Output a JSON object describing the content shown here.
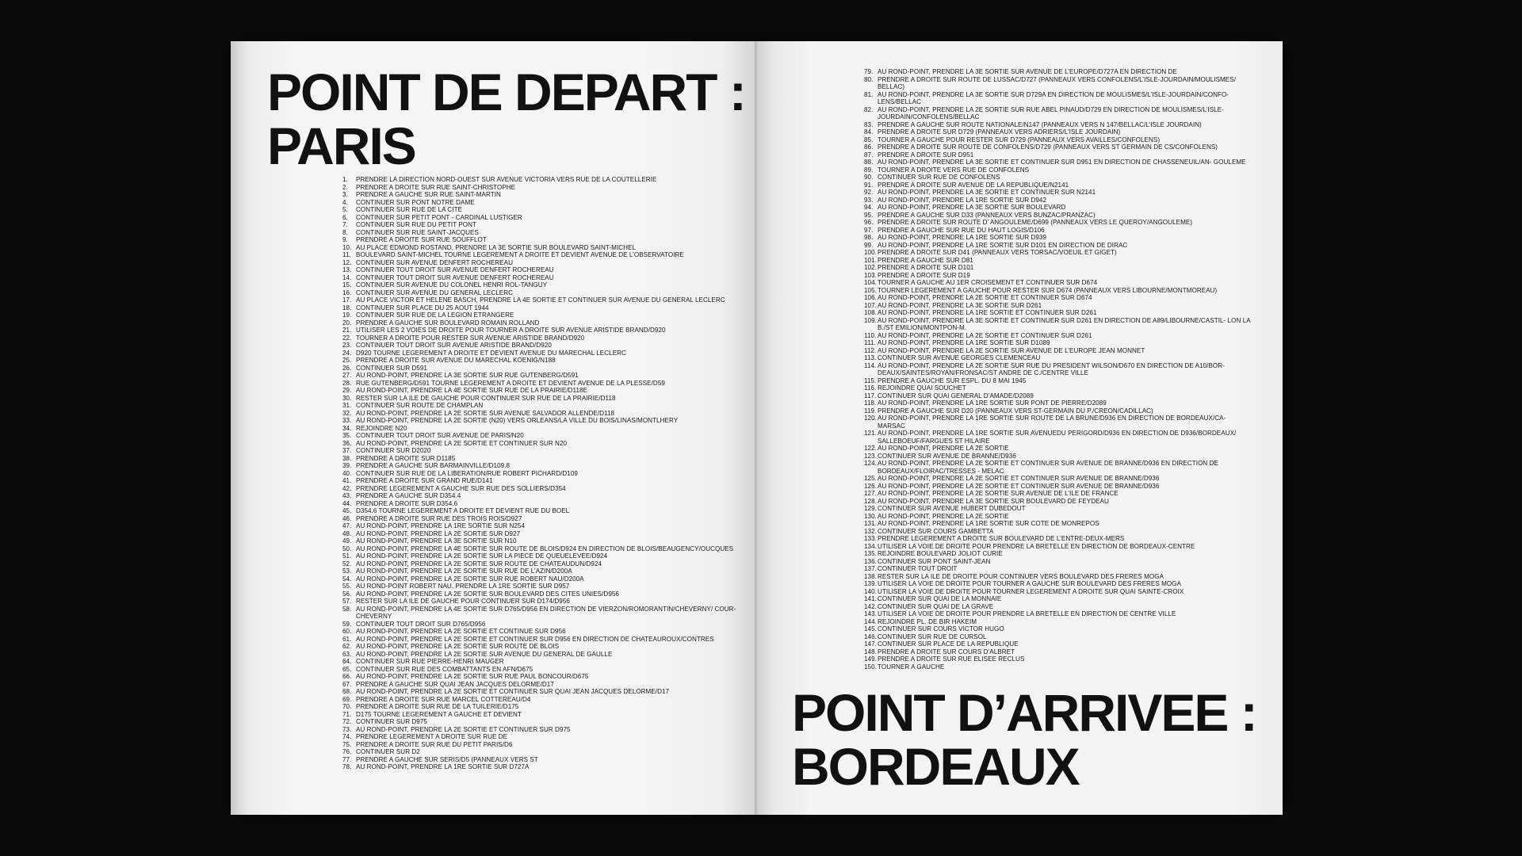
{
  "departure": {
    "label": "POINT DE DEPART :",
    "city": "PARIS"
  },
  "arrival": {
    "label": "POINT D’ARRIVEE :",
    "city": "BORDEAUX"
  },
  "steps_left": [
    {
      "num": "1.",
      "text": "PRENDRE LA DIRECTION NORD-OUEST SUR AVENUE VICTORIA VERS RUE DE LA COUTELLERIE"
    },
    {
      "num": "2.",
      "text": "PRENDRE A DROITE SUR RUE SAINT-CHRISTOPHE"
    },
    {
      "num": "3.",
      "text": "PRENDRE A GAUCHE SUR RUE SAINT-MARTIN"
    },
    {
      "num": "4.",
      "text": "CONTINUER SUR PONT NOTRE DAME"
    },
    {
      "num": "5.",
      "text": "CONTINUER SUR RUE DE LA CITE"
    },
    {
      "num": "6.",
      "text": "CONTINUER SUR PETIT PONT - CARDINAL LUSTIGER"
    },
    {
      "num": "7.",
      "text": "CONTINUER SUR RUE DU PETIT PONT"
    },
    {
      "num": "8.",
      "text": "CONTINUER SUR RUE SAINT-JACQUES"
    },
    {
      "num": "9.",
      "text": "PRENDRE A DROITE SUR RUE SOUFFLOT"
    },
    {
      "num": "10.",
      "text": "AU PLACE EDMOND ROSTAND, PRENDRE LA 3E SORTIE SUR BOULEVARD SAINT-MICHEL"
    },
    {
      "num": "11.",
      "text": "BOULEVARD SAINT-MICHEL TOURNE LEGEREMENT A DROITE ET DEVIENT AVENUE DE L’OBSERVATOIRE"
    },
    {
      "num": "12.",
      "text": "CONTINUER SUR AVENUE DENFERT ROCHEREAU"
    },
    {
      "num": "13.",
      "text": "CONTINUER TOUT DROIT SUR AVENUE DENFERT ROCHEREAU"
    },
    {
      "num": "14.",
      "text": "CONTINUER TOUT DROIT SUR AVENUE DENFERT ROCHEREAU"
    },
    {
      "num": "15.",
      "text": "CONTINUER SUR AVENUE DU COLONEL HENRI ROL-TANGUY"
    },
    {
      "num": "16.",
      "text": "CONTINUER SUR AVENUE DU GENERAL LECLERC"
    },
    {
      "num": "17.",
      "text": "AU PLACE VICTOR ET HELENE BASCH, PRENDRE LA 4E SORTIE ET CONTINUER SUR AVENUE DU GENERAL LECLERC"
    },
    {
      "num": "18.",
      "text": "CONTINUER SUR PLACE DU 25 AOUT 1944"
    },
    {
      "num": "19.",
      "text": "CONTINUER SUR RUE DE LA LEGION ETRANGERE"
    },
    {
      "num": "20.",
      "text": "PRENDRE A GAUCHE SUR BOULEVARD ROMAIN ROLLAND"
    },
    {
      "num": "21.",
      "text": "UTILISER LES 2 VOIES DE DROITE POUR TOURNER A DROITE SUR AVENUE ARISTIDE BRAND/D920"
    },
    {
      "num": "22.",
      "text": "TOURNER A DROITE POUR RESTER SUR AVENUE ARISTIDE BRAND/D920"
    },
    {
      "num": "23.",
      "text": "CONTINUER TOUT DROIT SUR AVENUE ARISTIDE BRAND/D920"
    },
    {
      "num": "24.",
      "text": "D920 TOURNE LEGEREMENT A DROITE ET DEVIENT AVENUE DU MARECHAL LECLERC"
    },
    {
      "num": "25.",
      "text": "PRENDRE A DROITE SUR AVENUE DU MARECHAL KOENIG/N188"
    },
    {
      "num": "26.",
      "text": "CONTINUER SUR D591"
    },
    {
      "num": "27.",
      "text": "AU ROND-POINT, PRENDRE LA 3E SORTIE SUR RUE GUTENBERG/D591"
    },
    {
      "num": "28.",
      "text": "RUE GUTENBERG/D591 TOURNE LEGEREMENT A DROITE ET DEVIENT AVENUE DE LA PLESSE/D59"
    },
    {
      "num": "29.",
      "text": "AU ROND-POINT, PRENDRE LA 4E SORTIE SUR RUE DE LA PRAIRIE/D118E"
    },
    {
      "num": "30.",
      "text": "RESTER SUR LA ILE DE GAUCHE POUR CONTINUER SUR RUE DE LA PRAIRIE/D118"
    },
    {
      "num": "31.",
      "text": "CONTINUER SUR ROUTE DE CHAMPLAN"
    },
    {
      "num": "32.",
      "text": "AU ROND-POINT, PRENDRE LA 2E SORTIE SUR AVENUE SALVADOR ALLENDE/D118"
    },
    {
      "num": "33.",
      "text": "AU ROND-POINT, PRENDRE LA 2E SORTIE (N20) VERS ORLEANS/LA VILLE DU BOIS/LINAS/MONTLHERY"
    },
    {
      "num": "34.",
      "text": "REJOINDRE N20"
    },
    {
      "num": "35.",
      "text": "CONTINUER TOUT DROIT SUR AVENUE DE PARIS/N20"
    },
    {
      "num": "36.",
      "text": "AU ROND-POINT, PRENDRE LA 2E SORTIE ET CONTINUER SUR N20"
    },
    {
      "num": "37.",
      "text": "CONTINUER SUR D2020"
    },
    {
      "num": "38.",
      "text": "PRENDRE A DROITE SUR D1185"
    },
    {
      "num": "39.",
      "text": "PRENDRE A GAUCHE SUR BARMAINVILLE/D109.8"
    },
    {
      "num": "40.",
      "text": "CONTINUER SUR RUE DE LA LIBERATION/RUE ROBERT PICHARD/D109"
    },
    {
      "num": "41.",
      "text": "PRENDRE A DROITE SUR GRAND RUE/D141"
    },
    {
      "num": "42.",
      "text": "PRENDRE LEGEREMENT A GAUCHE SUR RUE DES SOLLIERS/D354"
    },
    {
      "num": "43.",
      "text": "PRENDRE A GAUCHE SUR D354.4"
    },
    {
      "num": "44.",
      "text": "PRENDRE A DROITE SUR D354.6"
    },
    {
      "num": "45.",
      "text": "D354.6 TOURNE LEGEREMENT A DROITE ET DEVIENT RUE DU BOEL"
    },
    {
      "num": "46.",
      "text": "PRENDRE A DROITE SUR RUE DES TROIS ROIS/D927"
    },
    {
      "num": "47.",
      "text": "AU ROND-POINT, PRENDRE LA 1RE SORTIE SUR N254"
    },
    {
      "num": "48.",
      "text": "AU ROND-POINT, PRENDRE LA 2E SORTIE SUR D927"
    },
    {
      "num": "49.",
      "text": "AU ROND-POINT, PRENDRE LA 3E SORTIE SUR N10"
    },
    {
      "num": "50.",
      "text": "AU ROND-POINT, PRENDRE LA 4E SORTIE SUR ROUTE DE BLOIS/D924 EN DIRECTION DE BLOIS/BEAUGENCY/OUCQUES"
    },
    {
      "num": "51.",
      "text": "AU ROND-POINT, PRENDRE LA 2E SORTIE SUR LA PIECE DE QUEUELEVEE/D924"
    },
    {
      "num": "52.",
      "text": "AU ROND-POINT, PRENDRE LA 2E SORTIE SUR ROUTE DE CHATEAUDUN/D924"
    },
    {
      "num": "53.",
      "text": "AU ROND-POINT, PRENDRE LA 2E SORTIE SUR RUE DE L’AZIN/D200A"
    },
    {
      "num": "54.",
      "text": "AU ROND-POINT, PRENDRE LA 2E SORTIE SUR RUE ROBERT NAU/D200A"
    },
    {
      "num": "55.",
      "text": "AU ROND-POINT ROBERT NAU, PRENDRE LA 1RE SORTIE SUR D957"
    },
    {
      "num": "56.",
      "text": "AU ROND-POINT, PRENDRE LA 2E SORTIE SUR BOULEVARD DES CITES UNIES/D956"
    },
    {
      "num": "57.",
      "text": "RESTER SUR LA ILE DE GAUCHE POUR CONTINUER SUR D174/D956"
    },
    {
      "num": "58.",
      "text": "AU ROND-POINT, PRENDRE LA 4E SORTIE SUR D765/D956 EN DIRECTION DE VIERZON/ROMORANTIN/CHEVERNY/ COUR-CHEVERNY"
    },
    {
      "num": "59.",
      "text": "CONTINUER TOUT DROIT SUR D765/D956"
    },
    {
      "num": "60.",
      "text": "AU ROND-POINT, PRENDRE LA 2E SORTIE ET CONTINUE SUR D956"
    },
    {
      "num": "61.",
      "text": "AU ROND-POINT, PRENDRE LA 2E SORTIE ET CONTINUER SUR D956 EN DIRECTION DE CHATEAUROUX/CONTRES"
    },
    {
      "num": "62.",
      "text": "AU ROND-POINT, PRENDRE LA 2E SORTIE SUR ROUTE DE BLOIS"
    },
    {
      "num": "63.",
      "text": "AU ROND-POINT, PRENDRE LA 2E SORTIE SUR AVENUE DU GENERAL DE GAULLE"
    },
    {
      "num": "64.",
      "text": "CONTINUER SUR RUE PIERRE-HENRI MAUGER"
    },
    {
      "num": "65.",
      "text": "CONTINUER SUR RUE DES COMBATTANTS EN AFN/D675"
    },
    {
      "num": "66.",
      "text": "AU ROND-POINT, PRENDRE LA 2E SORTIE SUR RUE PAUL BONCOUR/D675"
    },
    {
      "num": "67.",
      "text": "PRENDRE A GAUCHE SUR QUAI JEAN JACQUES DELORME/D17"
    },
    {
      "num": "68.",
      "text": "AU ROND-POINT, PRENDRE LA 2E SORTIE ET CONTINUER SUR QUAI JEAN JACQUES DELORME/D17"
    },
    {
      "num": "69.",
      "text": "PRENDRE A DROITE SUR RUE MARCEL COTTEREAU/D4"
    },
    {
      "num": "70.",
      "text": "PRENDRE A DROITE SUR RUE DE LA TUILERIE/D175"
    },
    {
      "num": "71.",
      "text": "D175 TOURNE LEGEREMENT A GAUCHE ET DEVIENT"
    },
    {
      "num": "72.",
      "text": "CONTINUER SUR D975"
    },
    {
      "num": "73.",
      "text": "AU ROND-POINT, PRENDRE LA 2E SORTIE ET CONTINUER SUR D975"
    },
    {
      "num": "74.",
      "text": "PRENDRE LEGEREMENT A DROITE SUR RUE DE"
    },
    {
      "num": "75.",
      "text": "PRENDRE A DROITE SUR RUE DU PETIT PARIS/D6"
    },
    {
      "num": "76.",
      "text": "CONTINUER SUR D2"
    },
    {
      "num": "77.",
      "text": "PRENDRE A GAUCHE SUR SERIS/D5 (PANNEAUX VERS ST"
    },
    {
      "num": "78.",
      "text": "AU ROND-POINT, PRENDRE LA 1RE SORTIE SUR D727A"
    }
  ],
  "steps_right": [
    {
      "num": "79.",
      "text": "AU ROND-POINT, PRENDRE LA 3E SORTIE SUR AVENUE DE L’EUROPE/D727A EN DIRECTION DE"
    },
    {
      "num": "80.",
      "text": "PRENDRE A DROITE SUR ROUTE DE LUSSAC/D727 (PANNEAUX VERS CONFOLENS/L’ISLE-JOURDAIN/MOULISMES/ BELLAC)"
    },
    {
      "num": "81.",
      "text": "AU ROND-POINT, PRENDRE LA 3E SORTIE SUR D729A EN DIRECTION DE MOULISMES/L’ISLE-JOURDAIN/CONFO- LENS/BELLAC"
    },
    {
      "num": "82.",
      "text": "AU ROND-POINT, PRENDRE LA 2E SORTIE SUR RUE ABEL PINAUD/D729 EN DIRECTION DE MOULISMES/L’ISLE- JOURDAIN/CONFOLENS/BELLAC"
    },
    {
      "num": "83.",
      "text": "PRENDRE A GAUCHE SUR ROUTE NATIONALE/N147 (PANNEAUX VERS N 147/BELLAC/L’ISLE JOURDAIN)"
    },
    {
      "num": "84.",
      "text": "PRENDRE A DROITE SUR D729 (PANNEAUX VERS ADRIERS/L’ISLE JOURDAIN)"
    },
    {
      "num": "85.",
      "text": "TOURNER A GAUCHE POUR RESTER SUR D729 (PANNEAUX VERS AVAILLES/CONFOLENS)"
    },
    {
      "num": "86.",
      "text": "PRENDRE A DROITE SUR ROUTE DE CONFOLENS/D729 (PANNEAUX VERS ST GERMAIN DE CS/CONFOLENS)"
    },
    {
      "num": "87.",
      "text": "PRENDRE A DROITE SUR D951"
    },
    {
      "num": "88.",
      "text": "AU ROND-POINT, PRENDRE LA 3E SORTIE ET CONTINUER SUR D951 EN DIRECTION DE CHASSENEUIL/AN- GOULEME"
    },
    {
      "num": "89.",
      "text": "TOURNER A DROITE VERS RUE DE CONFOLENS"
    },
    {
      "num": "90.",
      "text": "CONTINUER SUR RUE DE CONFOLENS"
    },
    {
      "num": "91.",
      "text": "PRENDRE A DROITE SUR AVENUE DE LA REPUBLIQUE/N2141"
    },
    {
      "num": "92.",
      "text": "AU ROND-POINT, PRENDRE LA 3E SORTIE ET CONTINUER SUR N2141"
    },
    {
      "num": "93.",
      "text": "AU ROND-POINT, PRENDRE LA 1RE SORTIE SUR D942"
    },
    {
      "num": "94.",
      "text": "AU ROND-POINT, PRENDRE LA 3E SORTIE SUR BOULEVARD"
    },
    {
      "num": "95.",
      "text": "PRENDRE A GAUCHE SUR D33 (PANNEAUX VERS BUNZAC/PRANZAC)"
    },
    {
      "num": "96.",
      "text": "PRENDRE A DROITE SUR ROUTE D’ ANGOULEME/D699 (PANNEAUX VERS LE QUEROY/ANGOULEME)"
    },
    {
      "num": "97.",
      "text": "PRENDRE A GAUCHE SUR RUE DU HAUT LOGIS/D106"
    },
    {
      "num": "98.",
      "text": "AU ROND-POINT, PRENDRE LA 1RE SORTIE SUR D939"
    },
    {
      "num": "99.",
      "text": "AU ROND-POINT, PRENDRE LA 1RE SORTIE SUR D101 EN DIRECTION DE DIRAC"
    },
    {
      "num": "100.",
      "text": "PRENDRE A DROITE SUR D41 (PANNEAUX VERS TORSAC/VOEUIL ET GIGET)"
    },
    {
      "num": "101.",
      "text": "PRENDRE A GAUCHE SUR D81"
    },
    {
      "num": "102.",
      "text": "PRENDRE A DROITE SUR D101"
    },
    {
      "num": "103.",
      "text": "PRENDRE A DROITE SUR D19"
    },
    {
      "num": "104.",
      "text": "TOURNER A GAUCHE AU 1ER CROISEMENT ET CONTINUER SUR D674"
    },
    {
      "num": "105.",
      "text": "TOURNER LEGEREMENT A GAUCHE POUR RESTER SUR D674 (PANNEAUX VERS LIBOURNE/MONTMOREAU)"
    },
    {
      "num": "106.",
      "text": "AU ROND-POINT, PRENDRE LA 2E SORTIE ET CONTINUER SUR D674"
    },
    {
      "num": "107.",
      "text": "AU ROND-POINT, PRENDRE LA 3E SORTIE SUR D261"
    },
    {
      "num": "108.",
      "text": "AU ROND-POINT, PRENDRE LA 1RE SORTIE ET CONTINUER SUR D261"
    },
    {
      "num": "109.",
      "text": "AU ROND-POINT, PRENDRE LA 3E SORTIE ET CONTINUER SUR D261 EN DIRECTION DE A89/LIBOURNE/CASTIL- LON LA B./ST EMILION/MONTPON-M."
    },
    {
      "num": "110.",
      "text": "AU ROND-POINT, PRENDRE LA 2E SORTIE ET CONTINUER SUR D261"
    },
    {
      "num": "111.",
      "text": "AU ROND-POINT, PRENDRE LA 1RE SORTIE SUR D1089"
    },
    {
      "num": "112.",
      "text": "AU ROND-POINT, PRENDRE LA 2E SORTIE SUR AVENUE DE L’EUROPE JEAN MONNET"
    },
    {
      "num": "113.",
      "text": "CONTINUER SUR AVENUE GEORGES CLEMENCEAU"
    },
    {
      "num": "114.",
      "text": "AU ROND-POINT, PRENDRE LA 2E SORTIE SUR RUE DU PRESIDENT WILSON/D670 EN DIRECTION DE A10/BOR- DEAUX/SAINTES/ROYAN/FRONSAC/ST ANDRE DE C./CENTRE VILLE"
    },
    {
      "num": "115.",
      "text": "PRENDRE A GAUCHE SUR ESPL. DU 8 MAI 1945"
    },
    {
      "num": "116.",
      "text": "REJOINDRE QUAI SOUCHET"
    },
    {
      "num": "117.",
      "text": "CONTINUER SUR QUAI GENERAL D’AMADE/D2089"
    },
    {
      "num": "118.",
      "text": "AU ROND-POINT, PRENDRE LA 1RE SORTIE SUR PONT DE PIERRE/D2089"
    },
    {
      "num": "119.",
      "text": "PRENDRE A GAUCHE SUR D20 (PANNEAUX VERS ST-GERMAIN DU P./CREON/CADILLAC)"
    },
    {
      "num": "120.",
      "text": "AU ROND-POINT, PRENDRE LA 1RE SORTIE SUR ROUTE DE LA BRUNE/D936 EN DIRECTION DE BORDEAUX/CA- MARSAC"
    },
    {
      "num": "121.",
      "text": "AU ROND-POINT, PRENDRE LA 1RE SORTIE SUR AVENUEDU PERIGORD/D936 EN DIRECTION DE D936/BORDEAUX/ SALLEBOEUF/FARGUES ST HILAIRE"
    },
    {
      "num": "122.",
      "text": "AU ROND-POINT, PRENDRE LA 2E SORTIE"
    },
    {
      "num": "123.",
      "text": "CONTINUER SUR AVENUE DE BRANNE/D936"
    },
    {
      "num": "124.",
      "text": "AU ROND-POINT, PRENDRE LA 2E SORTIE ET CONTINUER SUR AVENUE DE BRANNE/D936 EN DIRECTION DE BORDEAUX/FLOIRAC/TRESSES - MELAC"
    },
    {
      "num": "125.",
      "text": "AU ROND-POINT, PRENDRE LA 2E SORTIE ET CONTINUER SUR AVENUE DE BRANNE/D936"
    },
    {
      "num": "126.",
      "text": "AU ROND-POINT, PRENDRE LA 2E SORTIE ET CONTINUER SUR AVENUE DE BRANNE/D936"
    },
    {
      "num": "127.",
      "text": "AU ROND-POINT, PRENDRE LA 2E SORTIE SUR AVENUE DE L’ILE DE FRANCE"
    },
    {
      "num": "128.",
      "text": "AU ROND-POINT, PRENDRE LA 3E SORTIE SUR BOULEVARD DE FEYDEAU"
    },
    {
      "num": "129.",
      "text": "CONTINUER SUR AVENUE HUBERT DUBEDOUT"
    },
    {
      "num": "130.",
      "text": "AU ROND-POINT, PRENDRE LA 2E SORTIE"
    },
    {
      "num": "131.",
      "text": "AU ROND-POINT, PRENDRE LA 1RE SORTIE SUR COTE DE MONREPOS"
    },
    {
      "num": "132.",
      "text": "CONTINUER SUR COURS GAMBETTA"
    },
    {
      "num": "133.",
      "text": "PRENDRE LEGEREMENT A DROITE SUR BOULEVARD DE L’ENTRE-DEUX-MERS"
    },
    {
      "num": "134.",
      "text": "UTILISER LA VOIE DE DROITE POUR PRENDRE LA BRETELLE EN DIRECTION DE BORDEAUX-CENTRE"
    },
    {
      "num": "135.",
      "text": "REJOINDRE BOULEVARD JOLIOT CURIE"
    },
    {
      "num": "136.",
      "text": "CONTINUER SUR PONT SAINT-JEAN"
    },
    {
      "num": "137.",
      "text": "CONTINUER TOUT DROIT"
    },
    {
      "num": "138.",
      "text": "RESTER SUR LA ILE DE DROITE POUR CONTINUER VERS BOULEVARD DES FRERES MOGA"
    },
    {
      "num": "139.",
      "text": "UTILISER LA VOIE DE DROITE POUR TOURNER A GAUCHE SUR BOULEVARD DES FRERES MOGA"
    },
    {
      "num": "140.",
      "text": "UTILISER LA VOIE DE DROITE POUR TOURNER LEGEREMENT A DROITE SUR QUAI SAINTE-CROIX"
    },
    {
      "num": "141.",
      "text": "CONTINUER SUR QUAI DE LA MONNAIE"
    },
    {
      "num": "142.",
      "text": "CONTINUER SUR QUAI DE LA GRAVE"
    },
    {
      "num": "143.",
      "text": "UTILISER LA VOIE DE DROITE POUR PRENDRE LA BRETELLE EN DIRECTION DE CENTRE VILLE"
    },
    {
      "num": "144.",
      "text": "REJOINDRE PL. DE BIR HAKEIM"
    },
    {
      "num": "145.",
      "text": "CONTINUER SUR COURS VICTOR HUGO"
    },
    {
      "num": "146.",
      "text": "CONTINUER SUR RUE DE CURSOL"
    },
    {
      "num": "147.",
      "text": "CONTINUER SUR PLACE DE LA REPUBLIQUE"
    },
    {
      "num": "148.",
      "text": "PRENDRE A DROITE SUR COURS D’ALBRET"
    },
    {
      "num": "149.",
      "text": "PRENDRE A DROITE SUR RUE ELISEE RECLUS"
    },
    {
      "num": "150.",
      "text": "TOURNER A GAUCHE"
    }
  ]
}
